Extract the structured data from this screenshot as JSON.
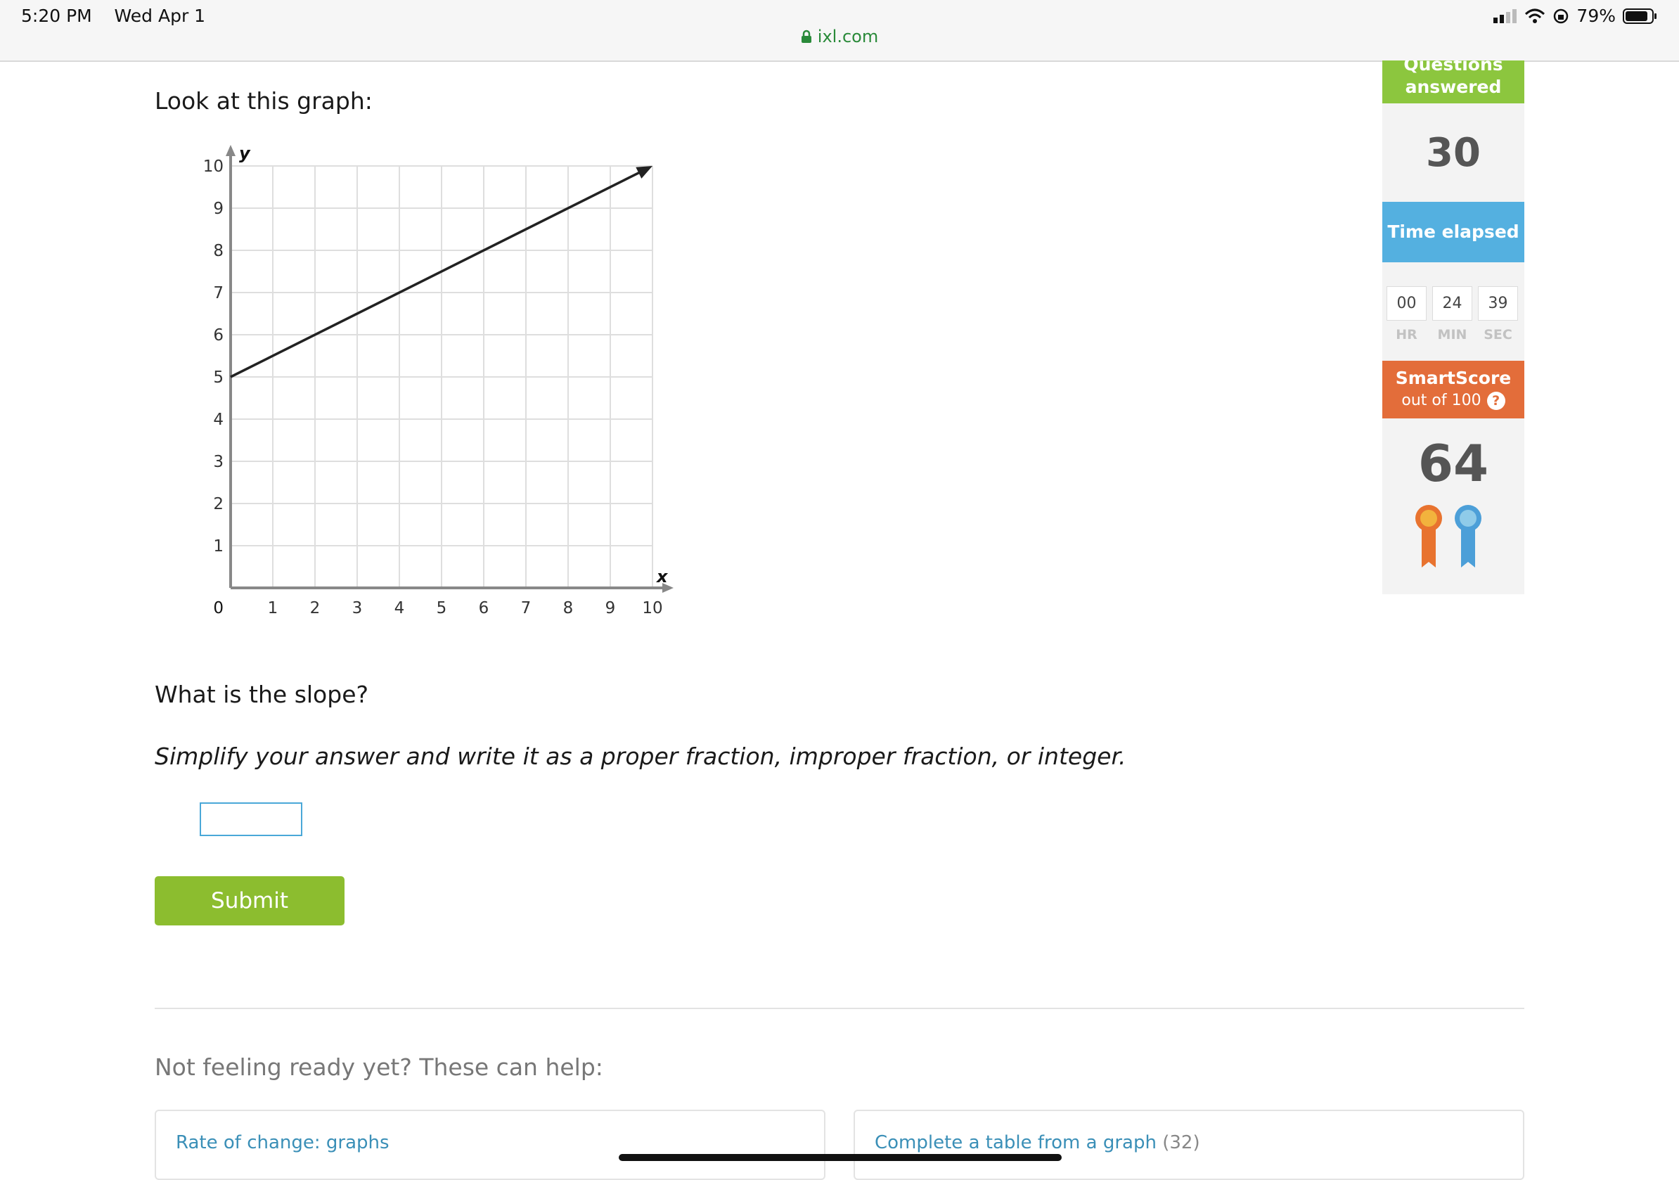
{
  "status_bar": {
    "time": "5:20 PM",
    "date": "Wed Apr 1",
    "battery": "79%",
    "url": "ixl.com"
  },
  "question": {
    "prompt": "Look at this graph:",
    "slope_question": "What is the slope?",
    "hint": "Simplify your answer and write it as a proper fraction, improper fraction, or integer.",
    "answer_value": "",
    "submit_label": "Submit"
  },
  "chart_data": {
    "type": "line",
    "xlabel": "x",
    "ylabel": "y",
    "xlim": [
      0,
      10
    ],
    "ylim": [
      0,
      10
    ],
    "x_ticks": [
      "1",
      "2",
      "3",
      "4",
      "5",
      "6",
      "7",
      "8",
      "9",
      "10"
    ],
    "y_ticks": [
      "1",
      "2",
      "3",
      "4",
      "5",
      "6",
      "7",
      "8",
      "9",
      "10"
    ],
    "origin_label": "0",
    "grid": true,
    "series": [
      {
        "x": [
          0,
          10
        ],
        "y": [
          5,
          10
        ]
      }
    ]
  },
  "sidebar": {
    "questions_answered_label": "Questions answered",
    "questions_answered_value": "30",
    "time_elapsed_label": "Time elapsed",
    "time": {
      "hr": "00",
      "min": "24",
      "sec": "39"
    },
    "time_units": {
      "hr": "HR",
      "min": "MIN",
      "sec": "SEC"
    },
    "smartscore_label": "SmartScore",
    "smartscore_sub": "out of 100",
    "smartscore_value": "64",
    "ribbon_colors": [
      "#e8732f",
      "#4c9fd8"
    ]
  },
  "help": {
    "title": "Not feeling ready yet? These can help:",
    "cards": [
      {
        "label": "Rate of change: graphs",
        "count": ""
      },
      {
        "label": "Complete a table from a graph",
        "count": "(32)"
      }
    ]
  }
}
